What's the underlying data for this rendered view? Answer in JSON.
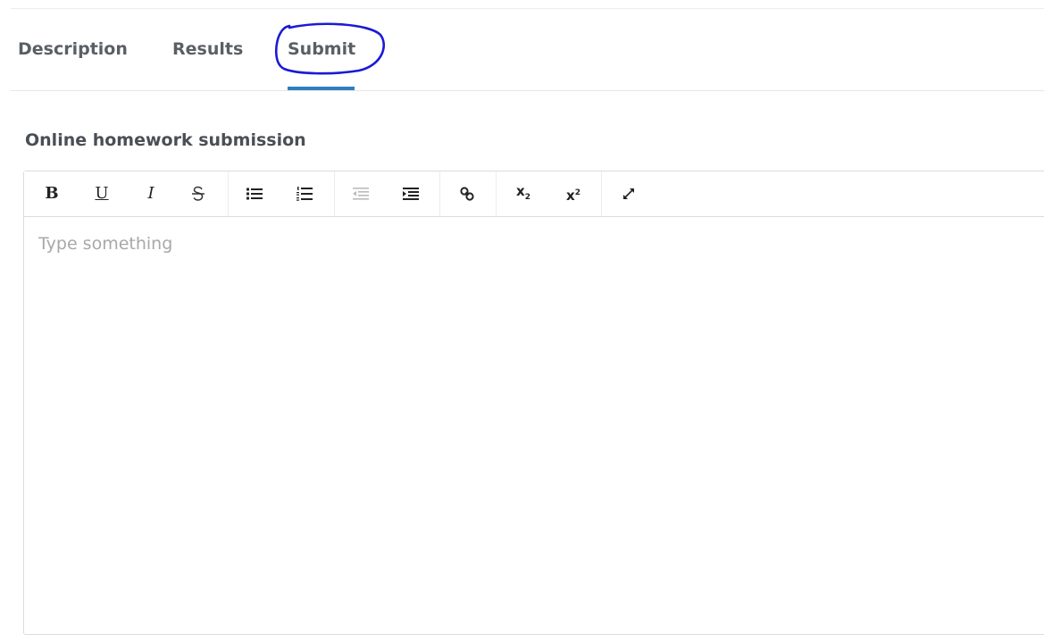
{
  "tabs": {
    "description": "Description",
    "results": "Results",
    "submit": "Submit",
    "active": "Submit"
  },
  "section": {
    "title": "Online homework submission"
  },
  "editor": {
    "placeholder": "Type something",
    "value": ""
  },
  "toolbar": {
    "bold": "B",
    "underline": "U",
    "italic": "I",
    "subscript_base": "x",
    "subscript_mark": "2",
    "superscript_base": "x",
    "superscript_mark": "2",
    "icons": [
      "bold-icon",
      "underline-icon",
      "italic-icon",
      "strikethrough-icon",
      "bullet-list-icon",
      "numbered-list-icon",
      "outdent-icon",
      "indent-icon",
      "link-icon",
      "subscript-icon",
      "superscript-icon",
      "fullscreen-icon"
    ]
  },
  "colors": {
    "accent": "#2f7ec2",
    "annotation": "#1a1ad6"
  }
}
